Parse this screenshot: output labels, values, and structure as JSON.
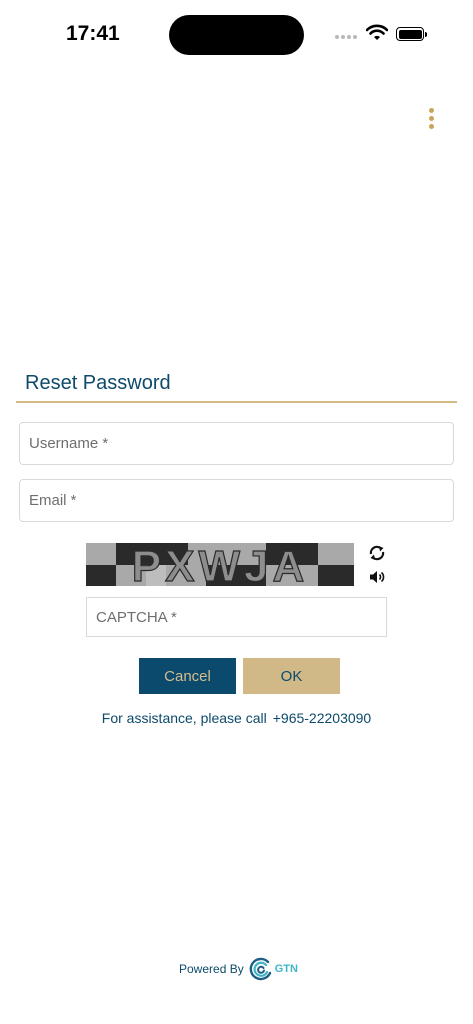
{
  "status_bar": {
    "time": "17:41"
  },
  "header": {
    "menu_icon": "more-vertical-icon"
  },
  "form": {
    "title": "Reset Password",
    "username_placeholder": "Username *",
    "email_placeholder": "Email *",
    "captcha_text": "PXWJA",
    "captcha_placeholder": "CAPTCHA *",
    "refresh_icon": "refresh-icon",
    "audio_icon": "speaker-icon",
    "cancel_label": "Cancel",
    "ok_label": "OK"
  },
  "assistance": {
    "text": "For assistance, please call",
    "phone": "+965-22203090"
  },
  "footer": {
    "powered_label": "Powered By",
    "brand": "GTN"
  },
  "colors": {
    "primary": "#0b4a6c",
    "accent": "#d0b987",
    "menu_dots": "#c9a45c",
    "brand_teal": "#3fb6c8"
  }
}
